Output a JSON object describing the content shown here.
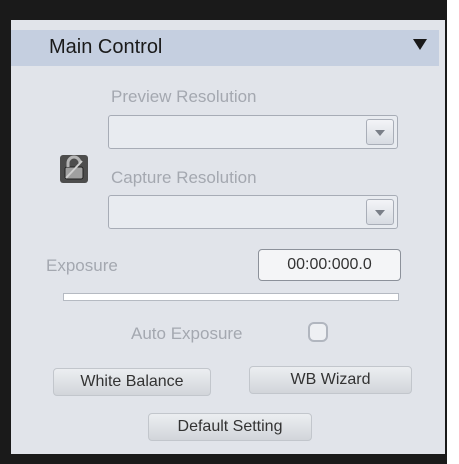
{
  "panel": {
    "title": "Main Control"
  },
  "preview_resolution": {
    "label": "Preview Resolution",
    "value": ""
  },
  "capture_resolution": {
    "label": "Capture Resolution",
    "value": ""
  },
  "exposure": {
    "label": "Exposure",
    "value": "00:00:000.0"
  },
  "auto_exposure": {
    "label": "Auto Exposure",
    "checked": false
  },
  "buttons": {
    "white_balance": "White Balance",
    "wb_wizard": "WB Wizard",
    "default_setting": "Default Setting"
  },
  "icons": {
    "collapse": "triangle-down-icon",
    "lock": "lock-icon",
    "dropdown": "chevron-down-icon"
  }
}
